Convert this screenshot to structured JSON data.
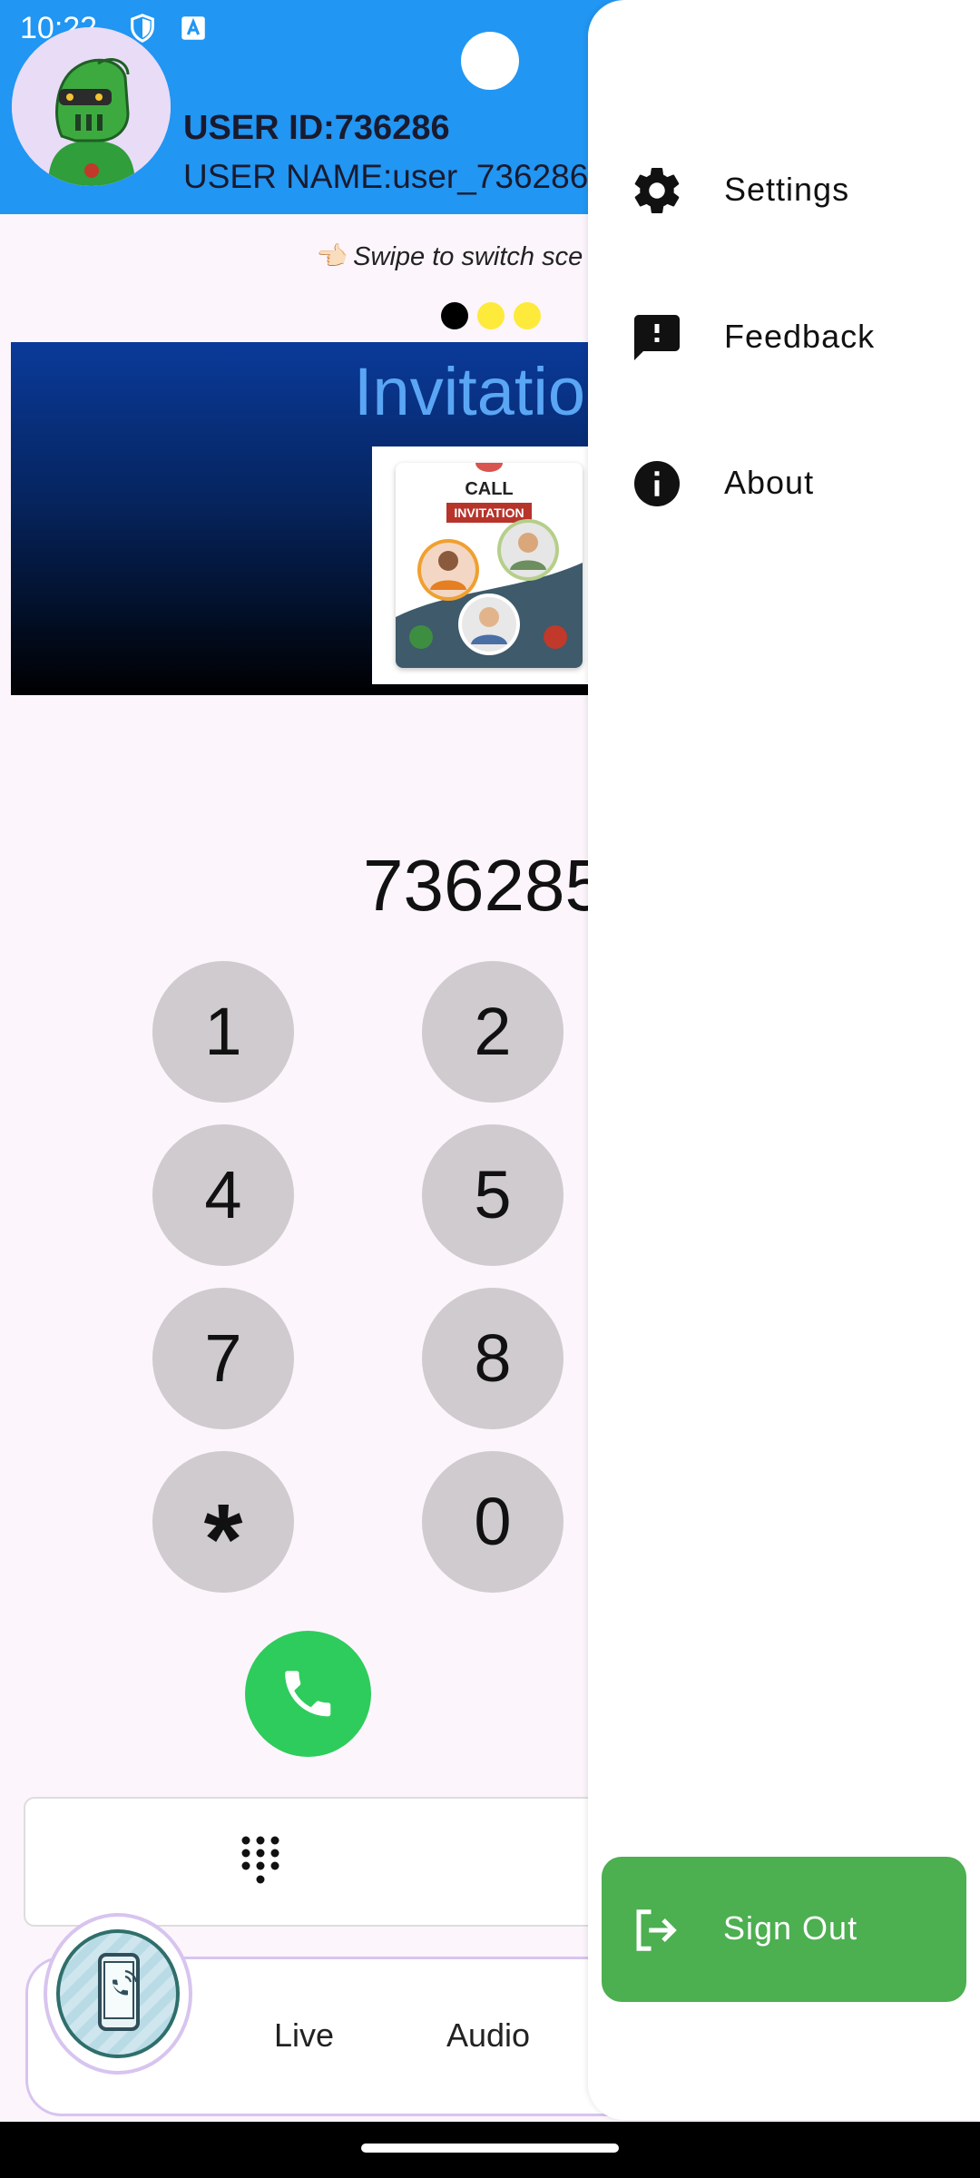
{
  "status_bar": {
    "time": "10:22"
  },
  "header": {
    "user_id": "USER ID:736286",
    "user_name": "USER NAME:user_736286"
  },
  "main": {
    "swipe_hint": "👈🏻 Swipe to switch sce",
    "page_dots": [
      "#000000",
      "#fdea3b",
      "#fdea3b"
    ],
    "banner": {
      "title": "Invitatio",
      "card_call": "CALL",
      "card_label": "INVITATION"
    },
    "dialed_number": "736285",
    "keys": [
      "1",
      "2",
      "4",
      "5",
      "7",
      "8",
      "*",
      "0"
    ]
  },
  "bottom_nav": {
    "items": [
      "Live",
      "Audio"
    ]
  },
  "drawer": {
    "items": [
      {
        "label": "Settings",
        "icon": "gear-icon"
      },
      {
        "label": "Feedback",
        "icon": "feedback-icon"
      },
      {
        "label": "About",
        "icon": "info-icon"
      }
    ],
    "signout_label": "Sign Out"
  },
  "colors": {
    "header": "#2196f3",
    "call_button": "#2ecc5c",
    "signout": "#4caf50",
    "banner_title": "#5aa6f5"
  }
}
